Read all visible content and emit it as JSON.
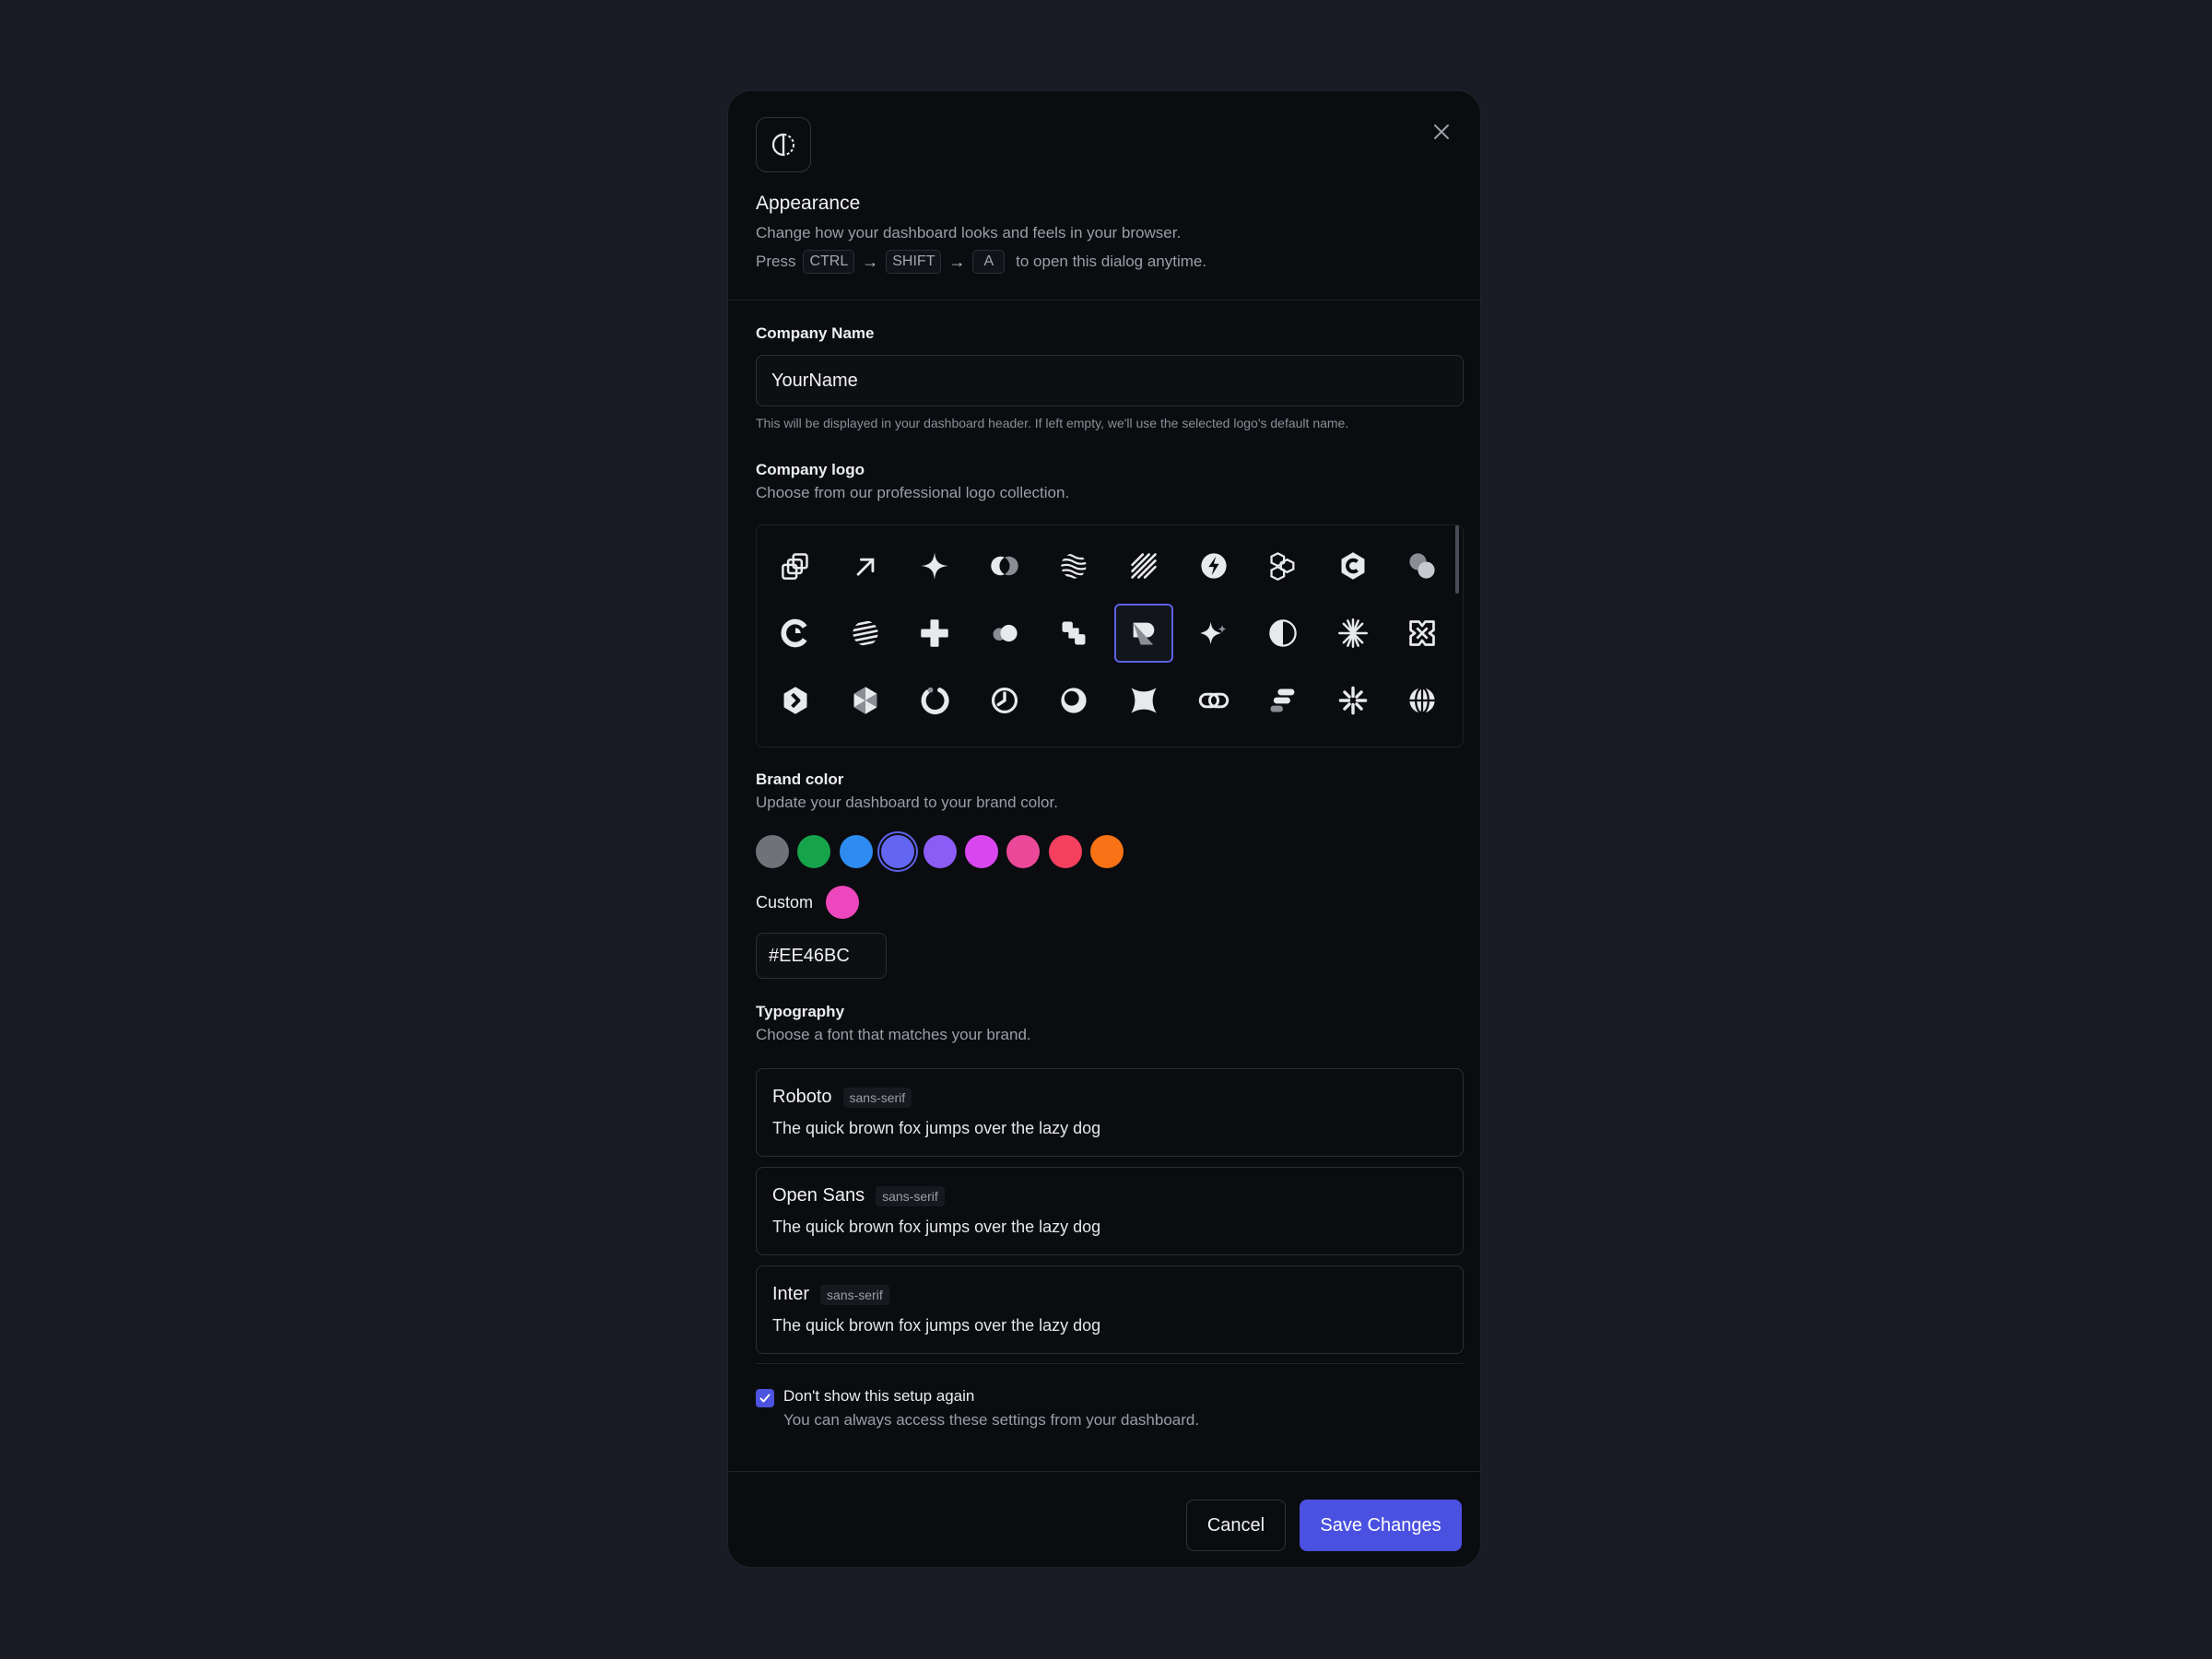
{
  "header": {
    "title": "Appearance",
    "subtitle": "Change how your dashboard looks and feels in your browser.",
    "press_prefix": "Press",
    "keys": [
      "CTRL",
      "SHIFT",
      "A"
    ],
    "press_suffix": "to open this dialog anytime."
  },
  "company_name": {
    "label": "Company Name",
    "value": "YourName",
    "help": "This will be displayed in your dashboard header. If left empty, we'll use the selected logo's default name."
  },
  "logo": {
    "label": "Company logo",
    "help": "Choose from our professional logo collection.",
    "selected_index": 15,
    "icons": [
      "stacked-layers-icon",
      "arrow-up-right-icon",
      "four-point-star-icon",
      "overlap-circles-icon",
      "waves-circle-icon",
      "diagonal-stripes-icon",
      "bolt-circle-icon",
      "cube-cluster-icon",
      "hexagon-c-icon",
      "two-circles-icon",
      "c-ring-icon",
      "striped-ball-icon",
      "plus-blob-icon",
      "pill-circles-icon",
      "steps-icon",
      "folded-r-icon",
      "sparkles-icon",
      "half-circle-icon",
      "starburst-icon",
      "x-frame-icon",
      "hexagon-chevron-icon",
      "cube-facets-icon",
      "dashed-ring-icon",
      "clock-circle-icon",
      "eclipse-icon",
      "concave-square-icon",
      "chain-link-icon",
      "stacked-bars-icon",
      "asterisk-icon",
      "globe-icon"
    ]
  },
  "brand": {
    "label": "Brand color",
    "help": "Update your dashboard to your brand color.",
    "selected_index": 3,
    "colors": [
      "#71717a",
      "#16a34a",
      "#2e8cf0",
      "#6366f1",
      "#8b5cf6",
      "#d946ef",
      "#ec4899",
      "#f43f5e",
      "#f97316"
    ],
    "custom_label": "Custom",
    "custom_color": "#EE46BC",
    "custom_value": "#EE46BC"
  },
  "typography": {
    "label": "Typography",
    "help": "Choose a font that matches your brand.",
    "fonts": [
      {
        "name": "Roboto",
        "category": "sans-serif",
        "sample": "The quick brown fox jumps over the lazy dog"
      },
      {
        "name": "Open Sans",
        "category": "sans-serif",
        "sample": "The quick brown fox jumps over the lazy dog"
      },
      {
        "name": "Inter",
        "category": "sans-serif",
        "sample": "The quick brown fox jumps over the lazy dog"
      }
    ]
  },
  "dont_show": {
    "label": "Don't show this setup again",
    "help": "You can always access these settings from your dashboard.",
    "checked": true
  },
  "footer": {
    "cancel_label": "Cancel",
    "save_label": "Save Changes"
  },
  "colors": {
    "accent": "#4a51e0",
    "background": "#191c24",
    "modal": "#0b0c10"
  }
}
